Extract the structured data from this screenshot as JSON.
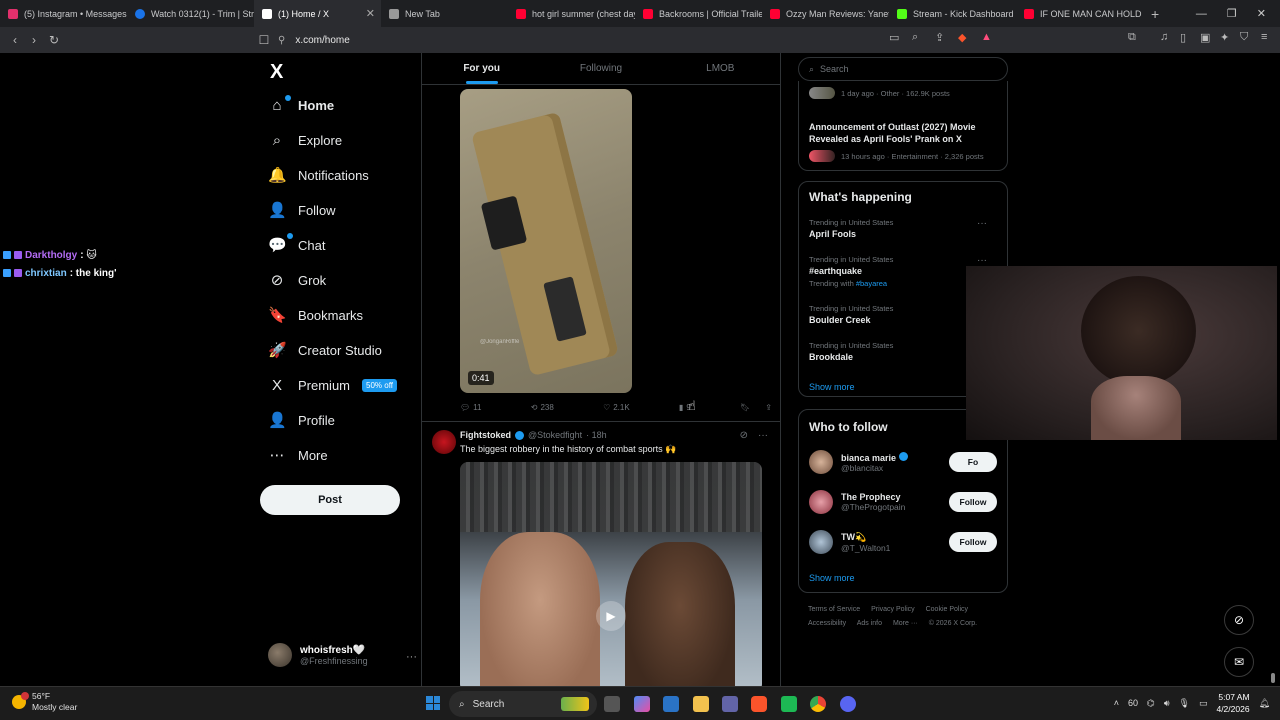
{
  "browser": {
    "tabs": [
      {
        "label": "(5) Instagram • Messages",
        "color": "#e1306c"
      },
      {
        "label": "Watch 0312(1) - Trim | Stre",
        "color": "#1a73e8"
      },
      {
        "label": "(1) Home / X",
        "color": "#ffffff",
        "active": true
      },
      {
        "label": "New Tab",
        "color": "#999999"
      },
      {
        "label": "hot girl summer (chest day",
        "color": "#ff0033"
      },
      {
        "label": "Backrooms | Official Traile",
        "color": "#ff0033"
      },
      {
        "label": "Ozzy Man Reviews: Yanet",
        "color": "#ff0033"
      },
      {
        "label": "Stream - Kick Dashboard",
        "color": "#53fc18"
      },
      {
        "label": "IF ONE MAN CAN HOLD I...",
        "color": "#ff0033"
      }
    ],
    "url": "x.com/home"
  },
  "stream_chat": [
    {
      "user": "Darktholgy",
      "message": " : 🐱"
    },
    {
      "user": "chrixtian",
      "message": " : the king'"
    }
  ],
  "nav": {
    "logo": "X",
    "items": [
      {
        "label": "Home",
        "icon": "⌂"
      },
      {
        "label": "Explore",
        "icon": "⌕"
      },
      {
        "label": "Notifications",
        "icon": "🔔"
      },
      {
        "label": "Follow",
        "icon": "👤"
      },
      {
        "label": "Chat",
        "icon": "💬"
      },
      {
        "label": "Grok",
        "icon": "⊘"
      },
      {
        "label": "Bookmarks",
        "icon": "🔖"
      },
      {
        "label": "Creator Studio",
        "icon": "🚀"
      },
      {
        "label": "Premium",
        "icon": "X"
      },
      {
        "label": "Profile",
        "icon": "👤"
      },
      {
        "label": "More",
        "icon": "⋯"
      }
    ],
    "premium_badge": "50% off",
    "post_button": "Post",
    "account": {
      "name": "whoisfresh🤍",
      "handle": "@Freshfinessing",
      "more": "···"
    }
  },
  "feed": {
    "tabs": [
      "For you",
      "Following",
      "LMOB"
    ],
    "post1": {
      "duration": "0:41",
      "watermark": "@JonganRiffle",
      "replies": "11",
      "reposts": "238",
      "likes": "2.1K",
      "views": "9"
    },
    "post2": {
      "name": "Fightstoked",
      "handle": "@Stokedfight",
      "time": "· 18h",
      "text": "The biggest robbery in the history of combat sports 🙌"
    }
  },
  "right": {
    "search_placeholder": "Search",
    "top_card": [
      {
        "meta": "1 day ago · Other · 162.9K posts",
        "title": ""
      },
      {
        "meta": "13 hours ago · Entertainment · 2,326 posts",
        "title": "Announcement of Outlast (2027) Movie Revealed as April Fools' Prank on X"
      }
    ],
    "happening": {
      "title": "What's happening",
      "trends": [
        {
          "meta": "Trending in United States",
          "title": "April Fools",
          "with": ""
        },
        {
          "meta": "Trending in United States",
          "title": "#earthquake",
          "with_prefix": "Trending with ",
          "with": "#bayarea"
        },
        {
          "meta": "Trending in United States",
          "title": "Boulder Creek",
          "with": ""
        },
        {
          "meta": "Trending in United States",
          "title": "Brookdale",
          "with": ""
        }
      ],
      "show_more": "Show more"
    },
    "who_to_follow": {
      "title": "Who to follow",
      "people": [
        {
          "name": "bianca marie",
          "handle": "@blancitax",
          "button": "Fo"
        },
        {
          "name": "The Prophecy",
          "handle": "@TheProgotpain",
          "button": "Follow"
        },
        {
          "name": "TW💫",
          "handle": "@T_Walton1",
          "button": "Follow"
        }
      ],
      "show_more": "Show more"
    },
    "footer": [
      "Terms of Service",
      "Privacy Policy",
      "Cookie Policy",
      "Accessibility",
      "Ads info",
      "More ···",
      "© 2026 X Corp."
    ]
  },
  "taskbar": {
    "weather_temp": "56°F",
    "weather_desc": "Mostly clear",
    "search": "Search",
    "time": "5:07 AM",
    "date": "4/2/2026",
    "tray_badge": "60"
  }
}
